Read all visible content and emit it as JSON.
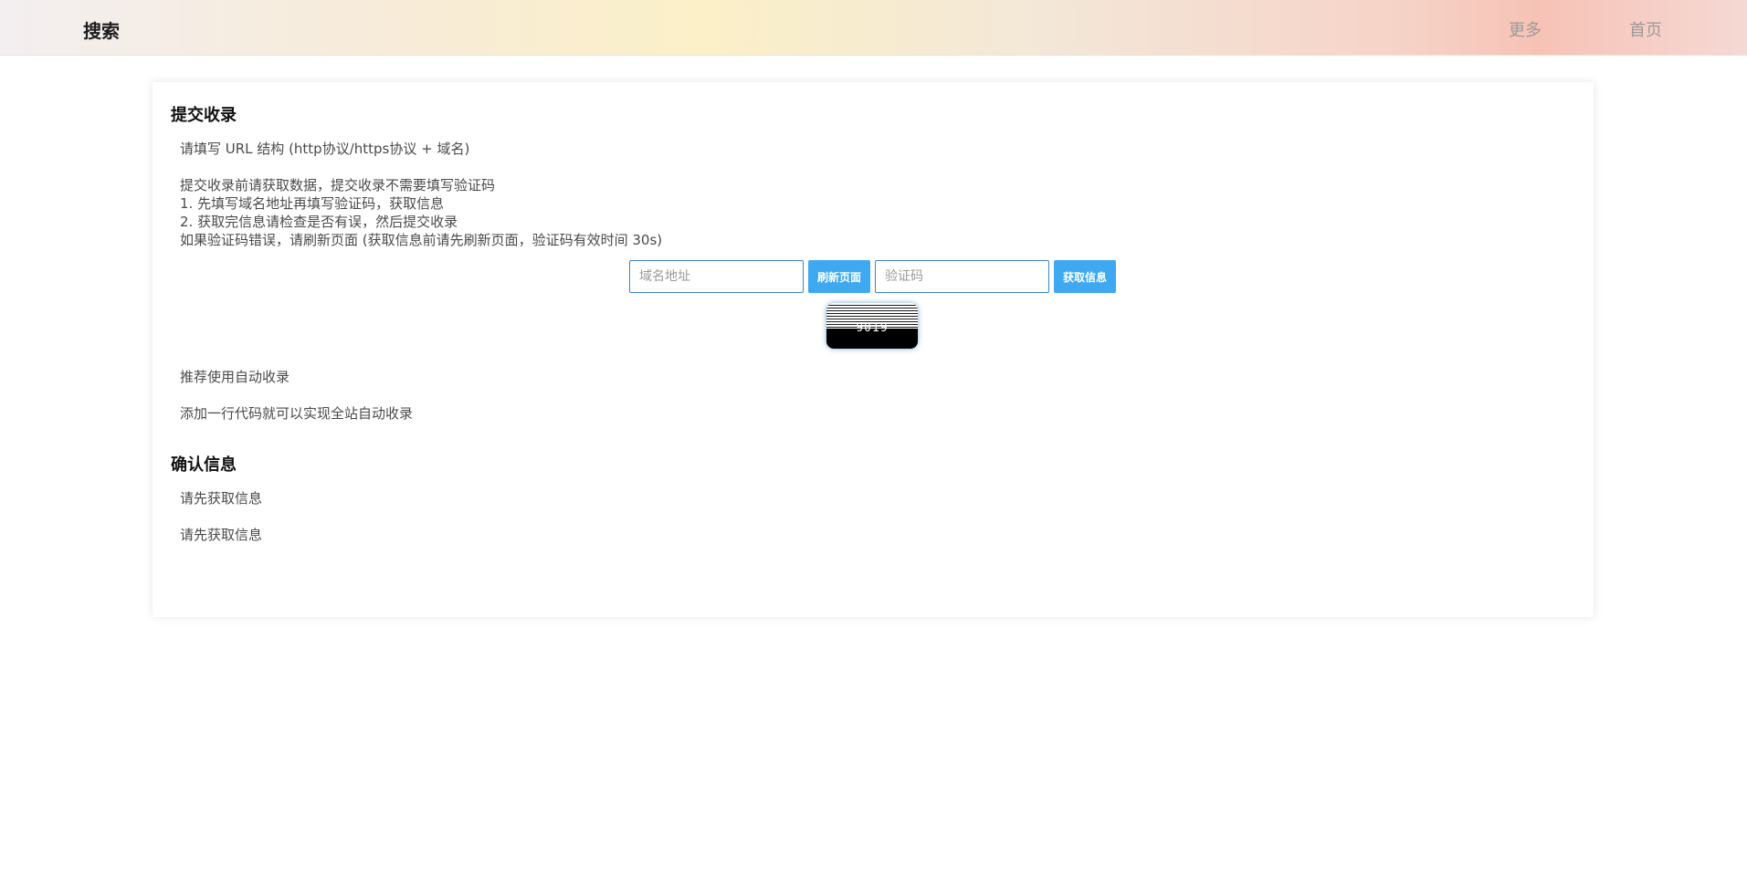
{
  "header": {
    "brand": "搜索",
    "nav": [
      "更多",
      "首页"
    ]
  },
  "submit_section": {
    "title": "提交收录",
    "instructions": [
      "请填写 URL 结构 (http协议/https协议 + 域名)",
      "提交收录前请获取数据，提交收录不需要填写验证码",
      "1. 先填写域名地址再填写验证码，获取信息",
      "2. 获取完信息请检查是否有误，然后提交收录",
      "如果验证码错误，请刷新页面 (获取信息前请先刷新页面，验证码有效时间 30s)"
    ],
    "domain_placeholder": "域名地址",
    "refresh_button": "刷新页面",
    "captcha_placeholder": "验证码",
    "fetch_button": "获取信息",
    "captcha_code": "9019",
    "recommend": "推荐使用自动收录",
    "recommend_desc": "添加一行代码就可以实现全站自动收录"
  },
  "confirm_section": {
    "title": "确认信息",
    "lines": [
      "请先获取信息",
      "请先获取信息"
    ]
  },
  "colors": {
    "accent": "#3ea9f0",
    "input_border": "#3e86c4"
  }
}
